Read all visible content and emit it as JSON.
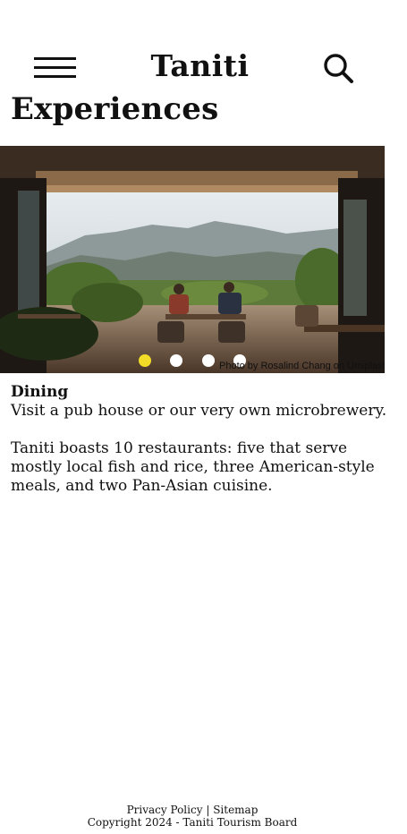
{
  "header": {
    "site_title": "Taniti",
    "menu_icon": "hamburger-menu-icon",
    "search_icon": "search-icon"
  },
  "page": {
    "title": "Experiences"
  },
  "carousel": {
    "photo_credit": "Photo by Rosalind Chang on Unsplash",
    "slide_count": 4,
    "active_index": 0,
    "active_dot_color": "#f2dc28",
    "inactive_dot_color": "#ffffff"
  },
  "section": {
    "heading": "Dining",
    "lead": "Visit a pub house or our very own microbrewery.",
    "body": "Taniti boasts 10 restaurants: five that serve mostly local fish and rice, three American-style meals, and two Pan-Asian cuisine."
  },
  "footer": {
    "privacy_label": "Privacy Policy",
    "separator": "|",
    "sitemap_label": "Sitemap",
    "copyright": "Copyright 2024 - Taniti Tourism Board"
  }
}
